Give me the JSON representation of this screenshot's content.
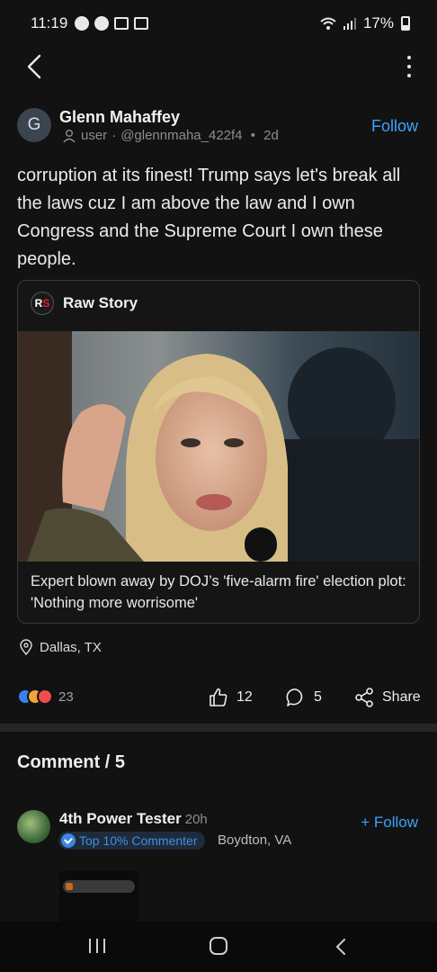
{
  "status_bar": {
    "time": "11:19",
    "battery": "17%",
    "icons": [
      "facebook-icon",
      "news-icon",
      "gallery-icon",
      "calendar-icon",
      "wifi-icon",
      "signal-icon",
      "battery-icon"
    ]
  },
  "nav": {
    "back_icon": "chevron-left-icon",
    "menu_icon": "more-vertical-icon"
  },
  "post": {
    "avatar_initial": "G",
    "author": "Glenn Mahaffey",
    "role": "user",
    "handle": "@glennmaha_422f4",
    "age": "2d",
    "follow_label": "Follow",
    "text": "corruption at its finest! Trump says let's break all the laws cuz I am above the law and I own Congress and the Supreme Court I own these people.",
    "link": {
      "source_logo": "RS",
      "source": "Raw Story",
      "title": "Expert blown away by DOJ’s 'five-alarm fire' election plot: 'Nothing more worrisome'"
    },
    "location": "Dallas, TX",
    "reaction_count": "23",
    "like_count": "12",
    "comment_count": "5",
    "share_label": "Share"
  },
  "comments": {
    "header": "Comment / 5",
    "items": [
      {
        "author": "4th Power Tester",
        "age": "20h",
        "badge": "Top 10% Commenter",
        "location": "Boydton, VA",
        "follow_label": "+ Follow"
      }
    ]
  },
  "colors": {
    "background": "#121212",
    "accent": "#3ea1ff",
    "text": "#ececec",
    "muted": "#8d8d8d"
  }
}
